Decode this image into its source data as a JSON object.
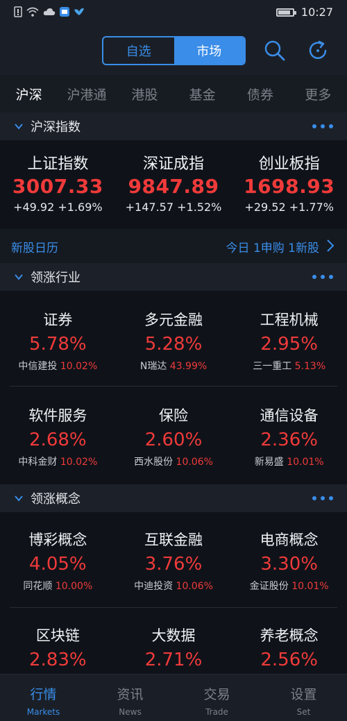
{
  "status": {
    "time": "10:27"
  },
  "header": {
    "seg_watchlist": "自选",
    "seg_market": "市场"
  },
  "tabs": [
    "沪深",
    "沪港通",
    "港股",
    "基金",
    "债券",
    "更多"
  ],
  "indices_section": {
    "title": "沪深指数",
    "items": [
      {
        "name": "上证指数",
        "value": "3007.33",
        "change": "+49.92  +1.69%"
      },
      {
        "name": "深证成指",
        "value": "9847.89",
        "change": "+147.57  +1.52%"
      },
      {
        "name": "创业板指",
        "value": "1698.93",
        "change": "+29.52  +1.77%"
      }
    ]
  },
  "ipo": {
    "label": "新股日历",
    "summary": "今日 1申购 1新股"
  },
  "industry_section": {
    "title": "领涨行业",
    "rows": [
      [
        {
          "name": "证券",
          "pct": "5.78%",
          "leader": "中信建投",
          "leader_pct": "10.02%"
        },
        {
          "name": "多元金融",
          "pct": "5.28%",
          "leader": "N瑞达",
          "leader_pct": "43.99%"
        },
        {
          "name": "工程机械",
          "pct": "2.95%",
          "leader": "三一重工",
          "leader_pct": "5.13%"
        }
      ],
      [
        {
          "name": "软件服务",
          "pct": "2.68%",
          "leader": "中科金财",
          "leader_pct": "10.02%"
        },
        {
          "name": "保险",
          "pct": "2.60%",
          "leader": "西水股份",
          "leader_pct": "10.06%"
        },
        {
          "name": "通信设备",
          "pct": "2.36%",
          "leader": "新易盛",
          "leader_pct": "10.01%"
        }
      ]
    ]
  },
  "concept_section": {
    "title": "领涨概念",
    "rows": [
      [
        {
          "name": "博彩概念",
          "pct": "4.05%",
          "leader": "同花顺",
          "leader_pct": "10.00%"
        },
        {
          "name": "互联金融",
          "pct": "3.76%",
          "leader": "中迪投资",
          "leader_pct": "10.06%"
        },
        {
          "name": "电商概念",
          "pct": "3.30%",
          "leader": "金证股份",
          "leader_pct": "10.01%"
        }
      ],
      [
        {
          "name": "区块链",
          "pct": "2.83%"
        },
        {
          "name": "大数据",
          "pct": "2.71%"
        },
        {
          "name": "养老概念",
          "pct": "2.56%"
        }
      ]
    ]
  },
  "bottom_nav": [
    {
      "zh": "行情",
      "en": "Markets"
    },
    {
      "zh": "资讯",
      "en": "News"
    },
    {
      "zh": "交易",
      "en": "Trade"
    },
    {
      "zh": "设置",
      "en": "Set"
    }
  ],
  "colors": {
    "accent": "#3a8de8",
    "up": "#f03a3a",
    "bg": "#0f1319"
  }
}
